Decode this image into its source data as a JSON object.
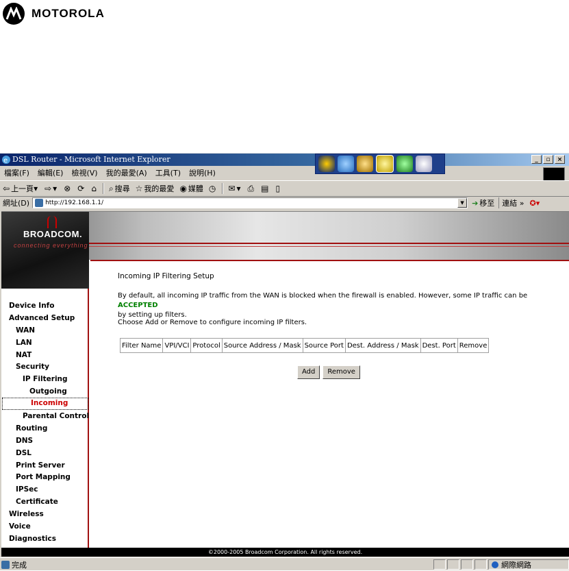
{
  "brand": {
    "name": "MOTOROLA"
  },
  "window": {
    "title": "DSL Router - Microsoft Internet Explorer",
    "menu": [
      "檔案(F)",
      "編輯(E)",
      "檢視(V)",
      "我的最愛(A)",
      "工具(T)",
      "說明(H)"
    ],
    "toolbar": {
      "back": "上一頁",
      "search": "搜尋",
      "favorites": "我的最愛",
      "media": "媒體"
    },
    "address_label": "網址(D)",
    "address_url": "http://192.168.1.1/",
    "go_label": "移至",
    "links_label": "連結"
  },
  "banner": {
    "logo": "BROADCOM.",
    "tagline": "connecting everything"
  },
  "nav": {
    "items": [
      {
        "label": "Device Info"
      },
      {
        "label": "Advanced Setup"
      },
      {
        "label": "WAN"
      },
      {
        "label": "LAN"
      },
      {
        "label": "NAT"
      },
      {
        "label": "Security"
      },
      {
        "label": "IP Filtering"
      },
      {
        "label": "Outgoing"
      },
      {
        "label": "Incoming"
      },
      {
        "label": "Parental Control"
      },
      {
        "label": "Routing"
      },
      {
        "label": "DNS"
      },
      {
        "label": "DSL"
      },
      {
        "label": "Print Server"
      },
      {
        "label": "Port Mapping"
      },
      {
        "label": "IPSec"
      },
      {
        "label": "Certificate"
      },
      {
        "label": "Wireless"
      },
      {
        "label": "Voice"
      },
      {
        "label": "Diagnostics"
      }
    ]
  },
  "main": {
    "title": "Incoming IP Filtering Setup",
    "desc_1": "By default, all incoming IP traffic from the WAN is blocked when the firewall is enabled. However, some IP traffic can be ",
    "desc_accepted": "ACCEPTED",
    "desc_2": "by setting up filters.",
    "instruction": "Choose Add or Remove to configure incoming IP filters.",
    "table_headers": [
      "Filter Name",
      "VPI/VCI",
      "Protocol",
      "Source Address / Mask",
      "Source Port",
      "Dest. Address / Mask",
      "Dest. Port",
      "Remove"
    ],
    "add_label": "Add",
    "remove_label": "Remove"
  },
  "footer": {
    "text": "©2000-2005 Broadcom Corporation. All rights reserved."
  },
  "status": {
    "text": "完成",
    "zone": "網際網路"
  }
}
